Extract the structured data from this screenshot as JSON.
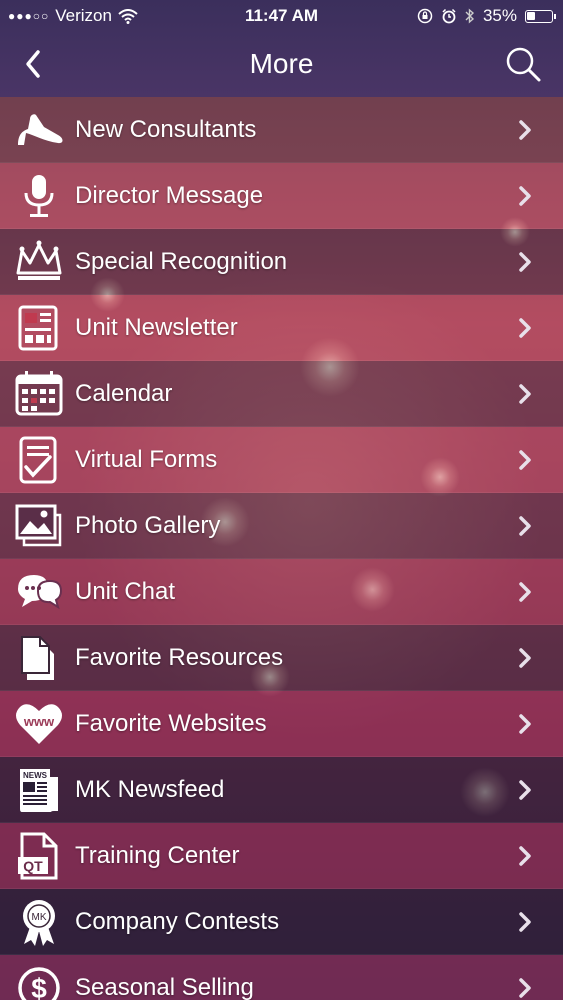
{
  "status_bar": {
    "carrier": "Verizon",
    "signal": "●●●○○",
    "time": "11:47 AM",
    "battery_percent": "35%",
    "battery_level": 0.35
  },
  "nav": {
    "title": "More"
  },
  "menu": {
    "items": [
      {
        "label": "New Consultants",
        "icon": "high-heel-icon"
      },
      {
        "label": "Director Message",
        "icon": "microphone-icon"
      },
      {
        "label": "Special Recognition",
        "icon": "crown-icon"
      },
      {
        "label": "Unit Newsletter",
        "icon": "newsletter-icon"
      },
      {
        "label": "Calendar",
        "icon": "calendar-icon"
      },
      {
        "label": "Virtual Forms",
        "icon": "form-checklist-icon"
      },
      {
        "label": "Photo Gallery",
        "icon": "photo-gallery-icon"
      },
      {
        "label": "Unit Chat",
        "icon": "chat-bubbles-icon"
      },
      {
        "label": "Favorite Resources",
        "icon": "documents-icon"
      },
      {
        "label": "Favorite Websites",
        "icon": "heart-www-icon"
      },
      {
        "label": "MK Newsfeed",
        "icon": "newspaper-icon"
      },
      {
        "label": "Training Center",
        "icon": "qt-document-icon"
      },
      {
        "label": "Company Contests",
        "icon": "award-ribbon-icon"
      },
      {
        "label": "Seasonal Selling",
        "icon": "dollar-circle-icon"
      }
    ],
    "icon_text": {
      "www": "www",
      "qt": "QT",
      "mk": "MK",
      "news": "NEWS",
      "dollar": "$"
    }
  },
  "colors": {
    "header": "#3b2f5c",
    "text": "#ffffff"
  }
}
